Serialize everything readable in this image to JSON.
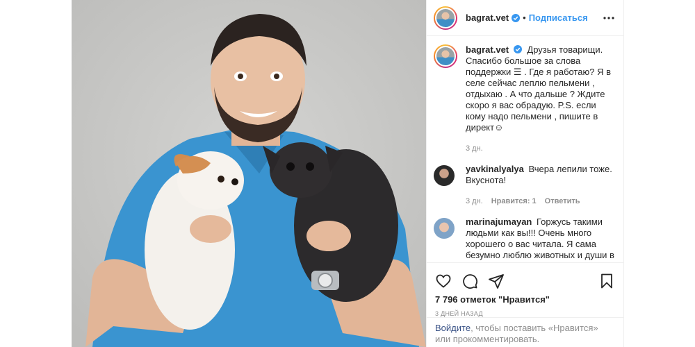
{
  "post": {
    "author": "bagrat.vet",
    "follow_label": "Подписаться",
    "separator": "•",
    "caption": "Друзья товарищи. Спасибо большое за слова поддержки ☰ . Где я работаю? Я в селе сейчас леплю пельмени , отдыхаю . А что дальше ? Ждите скоро я вас обрадую. P.S. если кому надо пельмени , пишите в директ☺",
    "caption_time": "3 дн."
  },
  "comments": [
    {
      "user": "yavkinalyalya",
      "text": "Вчера лепили тоже. Вкуснота!",
      "time": "3 дн.",
      "likes_label": "Нравится: 1",
      "reply_label": "Ответить"
    },
    {
      "user": "marinajumayan",
      "text": "Горжусь такими людьми как вы!!! Очень много хорошего о вас читала. Я сама безумно люблю животных и души в них чаю."
    }
  ],
  "stats": {
    "likes": "7 796 отметок \"Нравится\"",
    "date": "3 дней назад"
  },
  "login": {
    "link": "Войдите",
    "rest": ", чтобы поставить «Нравится» или прокомментировать."
  },
  "colors": {
    "accent": "#3897f0",
    "verified": "#3897f0",
    "scrubs": "#3a94d0",
    "background_photo": "#c9c9c7"
  },
  "icons": [
    "verified-badge-icon",
    "more-options-icon",
    "heart-icon",
    "comment-icon",
    "share-icon",
    "bookmark-icon"
  ]
}
